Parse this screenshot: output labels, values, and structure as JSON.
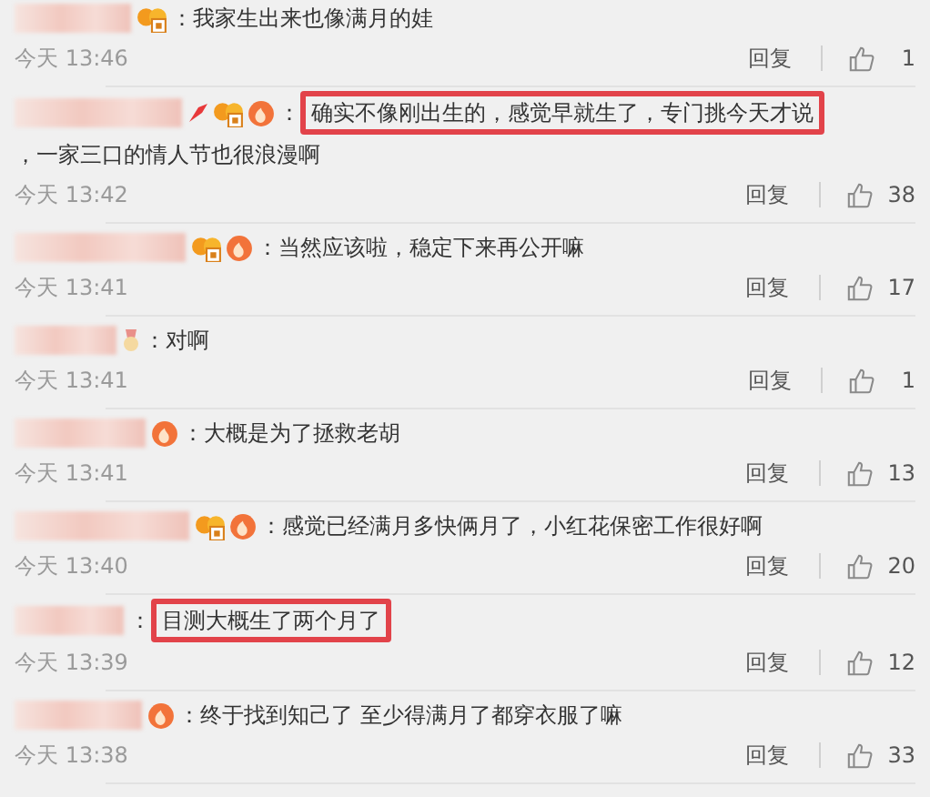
{
  "comments": [
    {
      "badges": [
        {
          "kind": "member"
        }
      ],
      "segments": [
        {
          "text": "：我家生出来也像满月的娃",
          "highlighted": false
        }
      ],
      "time": "今天 13:46",
      "reply": "回复",
      "likes": "1"
    },
    {
      "badges": [
        {
          "kind": "arrow"
        },
        {
          "kind": "member"
        },
        {
          "kind": "flame"
        }
      ],
      "segments": [
        {
          "text": "：",
          "highlighted": false
        },
        {
          "text": "确实不像刚出生的，感觉早就生了，专门挑今天才说",
          "highlighted": true
        },
        {
          "text": "，一家三口的情人节也很浪漫啊",
          "highlighted": false
        }
      ],
      "time": "今天 13:42",
      "reply": "回复",
      "likes": "38"
    },
    {
      "badges": [
        {
          "kind": "member"
        },
        {
          "kind": "flame"
        }
      ],
      "segments": [
        {
          "text": "：当然应该啦，稳定下来再公开嘛",
          "highlighted": false
        }
      ],
      "time": "今天 13:41",
      "reply": "回复",
      "likes": "17"
    },
    {
      "badges": [
        {
          "kind": "medal"
        }
      ],
      "segments": [
        {
          "text": "：对啊",
          "highlighted": false
        }
      ],
      "time": "今天 13:41",
      "reply": "回复",
      "likes": "1"
    },
    {
      "badges": [
        {
          "kind": "flame"
        }
      ],
      "segments": [
        {
          "text": "：大概是为了拯救老胡",
          "highlighted": false
        }
      ],
      "time": "今天 13:41",
      "reply": "回复",
      "likes": "13"
    },
    {
      "badges": [
        {
          "kind": "member"
        },
        {
          "kind": "flame"
        }
      ],
      "segments": [
        {
          "text": "：感觉已经满月多快俩月了，小红花保密工作很好啊",
          "highlighted": false
        }
      ],
      "time": "今天 13:40",
      "reply": "回复",
      "likes": "20"
    },
    {
      "segments": [
        {
          "text": "：",
          "highlighted": false
        },
        {
          "text": "目测大概生了两个月了",
          "highlighted": true
        }
      ],
      "time": "今天 13:39",
      "reply": "回复",
      "likes": "12"
    },
    {
      "badges": [
        {
          "kind": "flame"
        }
      ],
      "segments": [
        {
          "text": "：终于找到知己了 至少得满月了都穿衣服了嘛",
          "highlighted": false
        }
      ],
      "time": "今天 13:38",
      "reply": "回复",
      "likes": "33"
    }
  ]
}
